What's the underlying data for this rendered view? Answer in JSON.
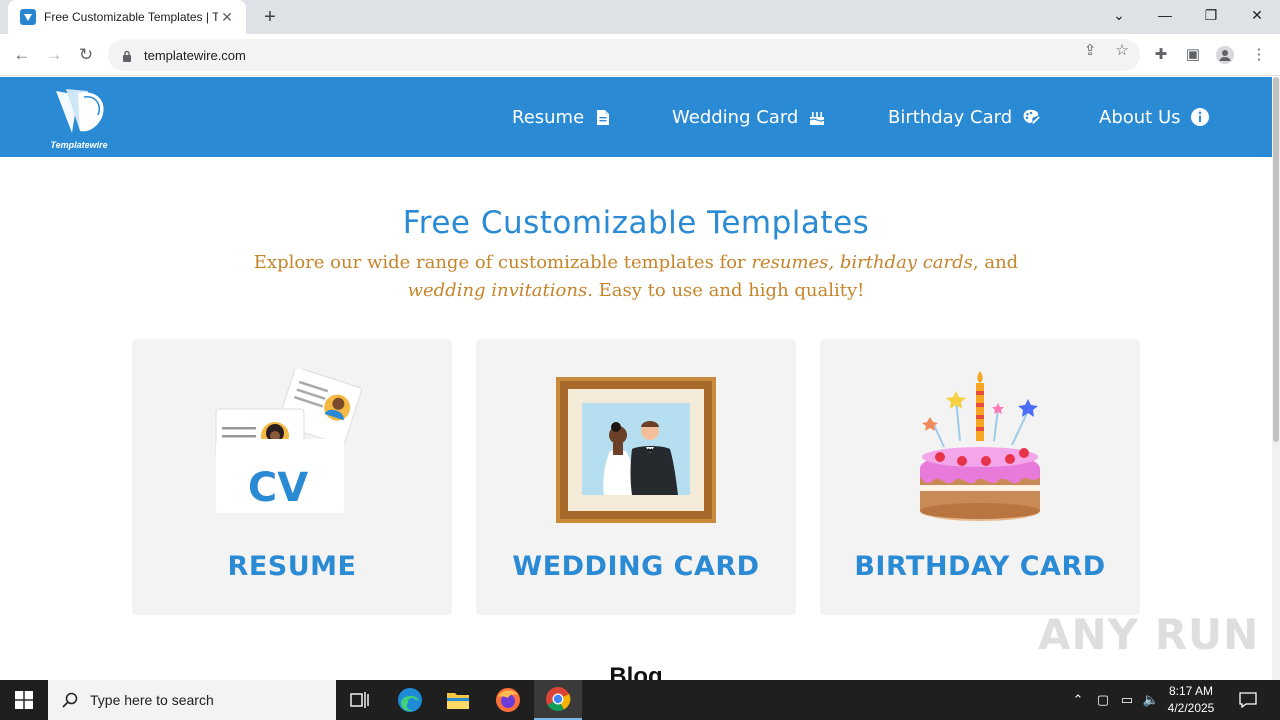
{
  "browser": {
    "tab_title": "Free Customizable Templates | Te",
    "url": "templatewire.com",
    "new_tab_label": "+",
    "tab_close_label": "✕"
  },
  "site": {
    "logo_text": "Templatewire",
    "nav": [
      {
        "label": "Resume",
        "icon": "document-icon"
      },
      {
        "label": "Wedding Card",
        "icon": "cake-icon"
      },
      {
        "label": "Birthday Card",
        "icon": "palette-icon"
      },
      {
        "label": "About Us",
        "icon": "info-icon"
      }
    ]
  },
  "hero": {
    "title": "Free Customizable Templates",
    "subtitle_parts": {
      "a": "Explore our wide range of customizable templates for ",
      "b": "resumes, birthday cards",
      "c": ", and ",
      "d": "wedding invitations",
      "e": ". Easy to use and high quality!"
    }
  },
  "cards": [
    {
      "title": "RESUME",
      "art_text": "CV"
    },
    {
      "title": "WEDDING CARD"
    },
    {
      "title": "BIRTHDAY CARD"
    }
  ],
  "blog_heading": "Blog",
  "watermark": "ANY RUN",
  "taskbar": {
    "search_placeholder": "Type here to search",
    "time": "8:17 AM",
    "date": "4/2/2025"
  },
  "colors": {
    "brand_blue": "#2a8ad4",
    "subtitle_gold": "#c5852a",
    "card_bg": "#f3f3f3"
  }
}
